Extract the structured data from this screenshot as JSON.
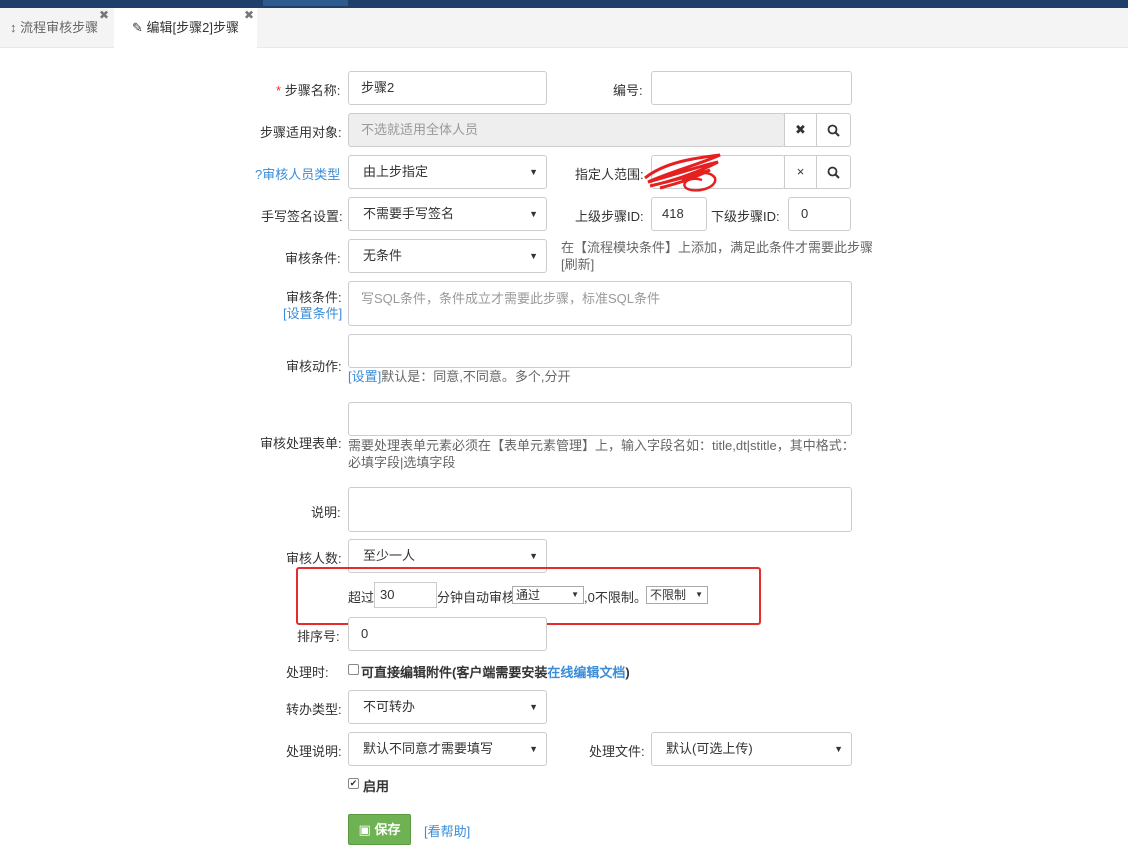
{
  "tabs": [
    {
      "icon": "sort-icon",
      "label": "流程审核步骤"
    },
    {
      "icon": "edit-icon",
      "label": "编辑[步骤2]步骤"
    }
  ],
  "form": {
    "step_name": {
      "required_mark": "*",
      "label": "步骤名称:",
      "value": "步骤2"
    },
    "number": {
      "label": "编号:",
      "value": ""
    },
    "applicable": {
      "label": "步骤适用对象:",
      "placeholder": "不选就适用全体人员"
    },
    "reviewer_type": {
      "label": "?审核人员类型",
      "value": "由上步指定"
    },
    "specified_range": {
      "label": "指定人范围:",
      "clear": "×"
    },
    "handwrite": {
      "label": "手写签名设置:",
      "value": "不需要手写签名"
    },
    "prev_step": {
      "label": "上级步骤ID:",
      "value": "418"
    },
    "next_step": {
      "label": "下级步骤ID:",
      "value": "0"
    },
    "condition": {
      "label": "审核条件:",
      "value": "无条件",
      "help": "在【流程模块条件】上添加，满足此条件才需要此步骤",
      "refresh": "[刷新]"
    },
    "sql_condition": {
      "label": "审核条件:",
      "link": "[设置条件]",
      "placeholder": "写SQL条件，条件成立才需要此步骤，标准SQL条件"
    },
    "action": {
      "label": "审核动作:",
      "link": "[设置]",
      "help": "默认是：同意,不同意。多个,分开"
    },
    "process_form": {
      "label": "审核处理表单:",
      "help_line1": "需要处理表单元素必须在【表单元素管理】上，输入字段名如：title,dt|stitle，其中格式：",
      "help_line2": "必填字段|选填字段"
    },
    "explain": {
      "label": "说明:"
    },
    "reviewer_count": {
      "label": "审核人数:",
      "value": "至少一人"
    },
    "auto": {
      "prefix": "超过",
      "minutes": "30",
      "middle": "分钟自动审核",
      "result": "通过",
      "suffix": ",0不限制。",
      "limit": "不限制"
    },
    "sort": {
      "label": "排序号:",
      "value": "0"
    },
    "handle_time": {
      "label": "处理时:",
      "text": "可直接编辑附件(客户端需要安装",
      "link": "在线编辑文档",
      "close": ")"
    },
    "transfer": {
      "label": "转办类型:",
      "value": "不可转办"
    },
    "handle_explain": {
      "label": "处理说明:",
      "value": "默认不同意才需要填写"
    },
    "handle_file": {
      "label": "处理文件:",
      "value": "默认(可选上传)"
    },
    "enable": {
      "label": "启用"
    },
    "save": "保存",
    "help": "[看帮助]"
  }
}
